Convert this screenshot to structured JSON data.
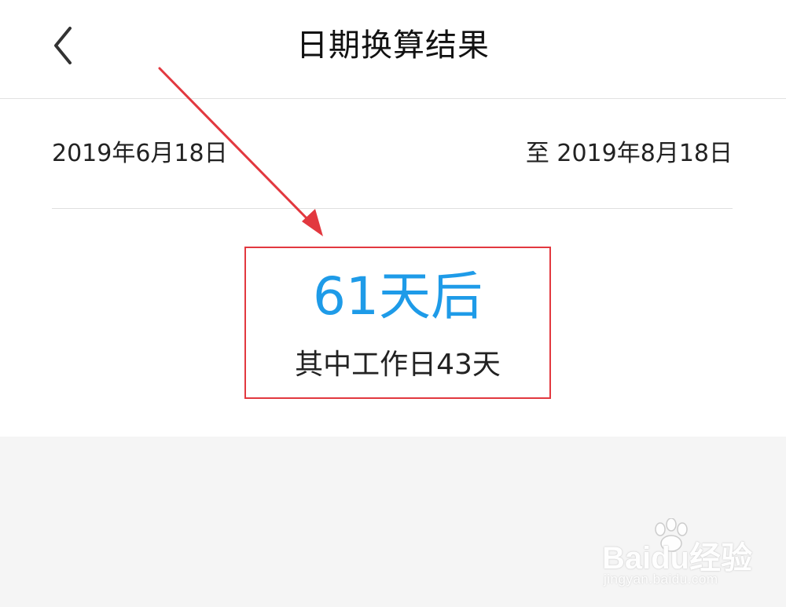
{
  "header": {
    "title": "日期换算结果",
    "back_icon": "chevron-left-icon"
  },
  "dates": {
    "start": "2019年6月18日",
    "end": "至 2019年8月18日"
  },
  "result": {
    "days_after": "61天后",
    "workdays": "其中工作日43天"
  },
  "watermark": {
    "logo_text": "Baidu经验",
    "url": "jingyan.baidu.com"
  },
  "colors": {
    "accent": "#1e9be8",
    "annotation": "#e2383f",
    "background": "#f5f5f5",
    "card": "#ffffff"
  }
}
